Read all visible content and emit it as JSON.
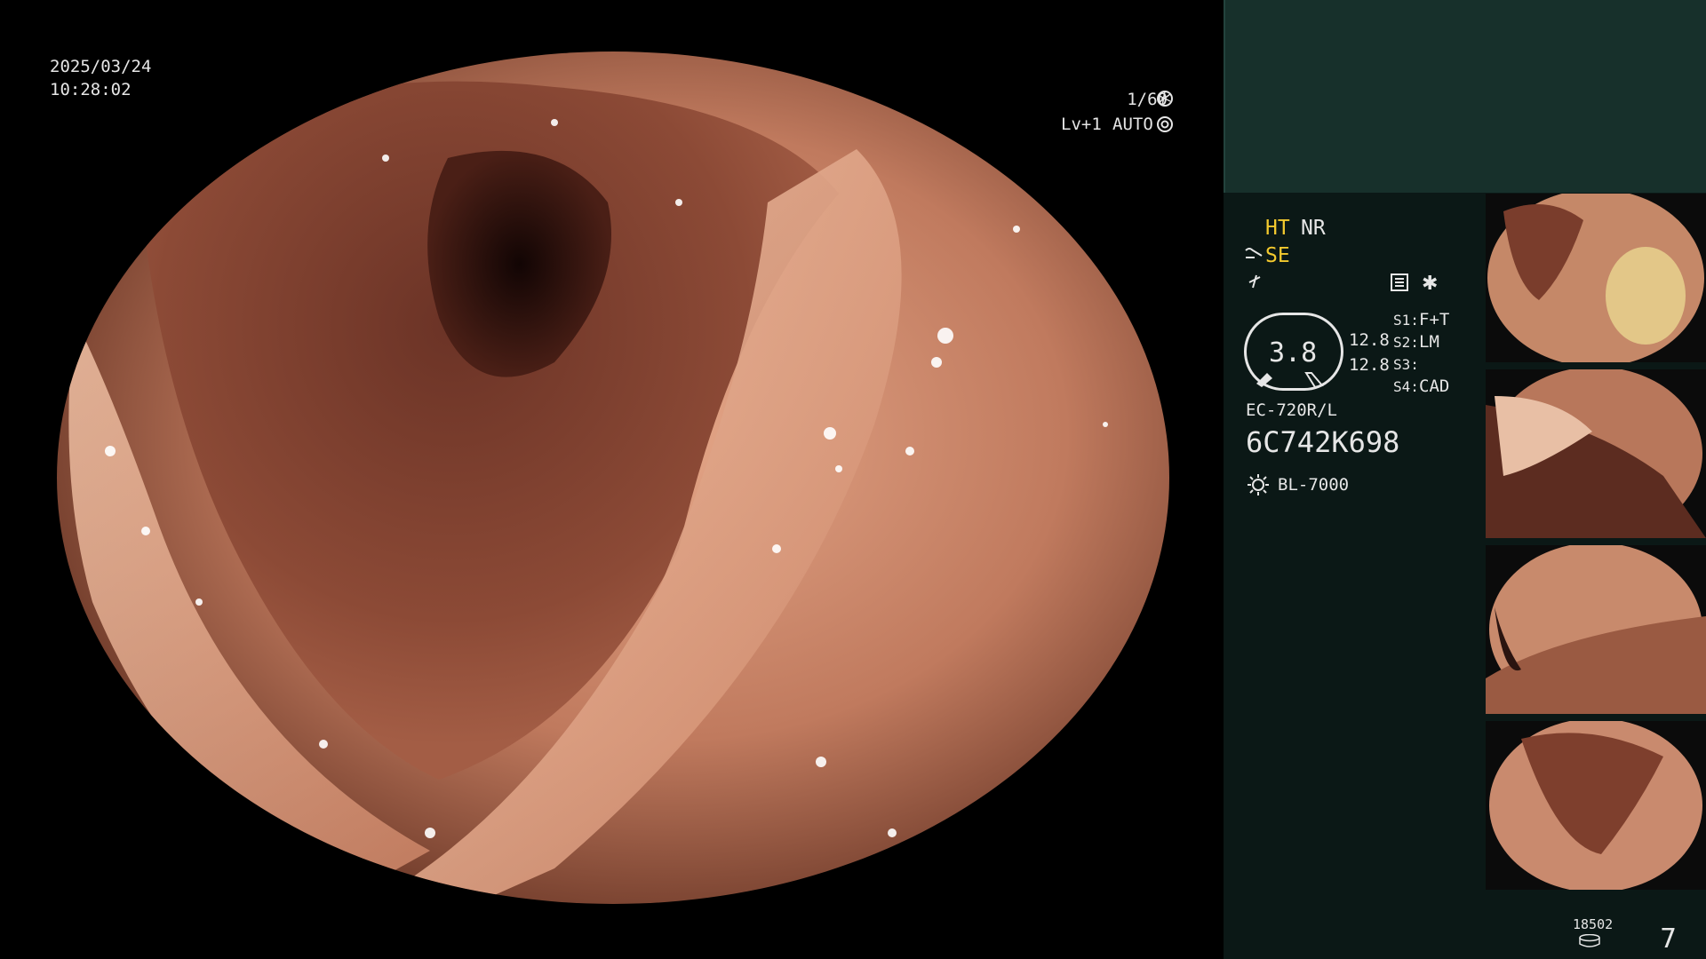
{
  "osd": {
    "date": "2025/03/24",
    "time": "10:28:02",
    "shutter": "1/60",
    "level": "Lv+1",
    "iris": "AUTO"
  },
  "settings": {
    "ht": "HT",
    "nr": "NR",
    "se": "SE",
    "zoom_value": "3.8",
    "value_top": "12.8",
    "value_bottom": "12.8",
    "s1_label": "S1:",
    "s1_value": "F+T",
    "s2_label": "S2:",
    "s2_value": "LM",
    "s3_label": "S3:",
    "s3_value": "",
    "s4_label": "S4:",
    "s4_value": "CAD"
  },
  "device": {
    "model": "EC-720R/L",
    "serial": "6C742K698",
    "light_source": "BL-7000"
  },
  "footer": {
    "counter": "18502",
    "image_count": "7"
  },
  "colors": {
    "highlight_yellow": "#f3c92e",
    "panel_bg": "#0b1816",
    "panel_top": "#17302b",
    "mucosa": "#b56a50"
  },
  "icons": {
    "shutter": "aperture-icon",
    "iris": "iris-icon",
    "enhance": "wave-icon",
    "freeze": "freeze-icon",
    "record": "record-icon",
    "asterisk": "asterisk-icon",
    "light": "sun-icon",
    "storage": "disk-icon"
  }
}
